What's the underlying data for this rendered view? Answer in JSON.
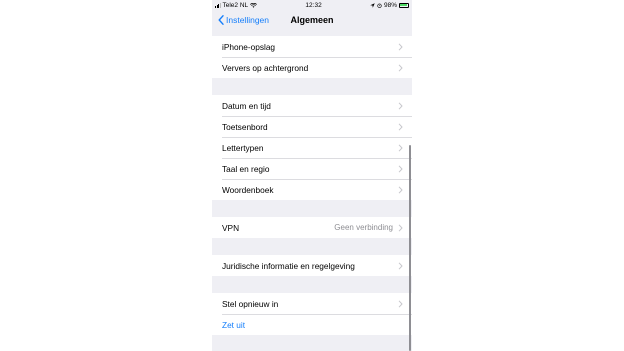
{
  "status": {
    "carrier": "Tele2 NL",
    "time": "12:32",
    "battery": "98%",
    "battery_level": 0.98
  },
  "nav": {
    "back_label": "Instellingen",
    "title": "Algemeen"
  },
  "groups": [
    {
      "rows": [
        {
          "label": "iPhone-opslag"
        },
        {
          "label": "Ververs op achtergrond"
        }
      ]
    },
    {
      "rows": [
        {
          "label": "Datum en tijd"
        },
        {
          "label": "Toetsenbord"
        },
        {
          "label": "Lettertypen"
        },
        {
          "label": "Taal en regio"
        },
        {
          "label": "Woordenboek"
        }
      ]
    },
    {
      "rows": [
        {
          "label": "VPN",
          "value": "Geen verbinding"
        }
      ]
    },
    {
      "rows": [
        {
          "label": "Juridische informatie en regelgeving"
        }
      ]
    },
    {
      "rows": [
        {
          "label": "Stel opnieuw in"
        },
        {
          "label": "Zet uit"
        }
      ]
    }
  ],
  "colors": {
    "accent": "#147efb",
    "background": "#efeff4",
    "chevron": "#c7c7cc"
  },
  "icons": [
    "signal-icon",
    "wifi-icon",
    "location-icon",
    "alarm-icon",
    "battery-icon",
    "back-chevron-icon",
    "chevron-right-icon"
  ]
}
